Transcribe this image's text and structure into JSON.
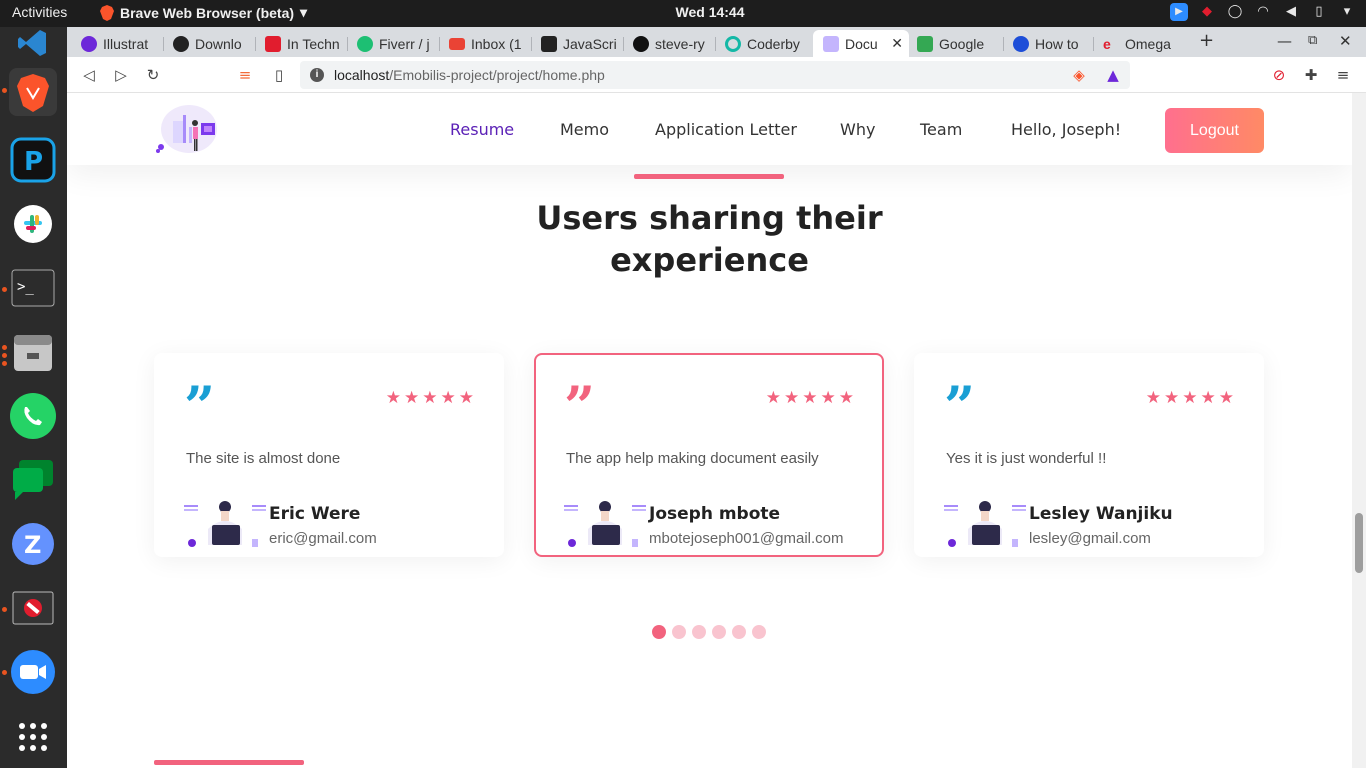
{
  "topbar": {
    "activities": "Activities",
    "app_name": "Brave Web Browser (beta)",
    "clock": "Wed 14:44"
  },
  "browser": {
    "tabs": [
      {
        "label": "Illustrat",
        "color": "#6d28d9"
      },
      {
        "label": "Downlo",
        "color": "#222222"
      },
      {
        "label": "In Techn",
        "color": "#e11d2e"
      },
      {
        "label": "Fiverr / j",
        "color": "#1dbf73"
      },
      {
        "label": "Inbox (1",
        "color": "#ea4335"
      },
      {
        "label": "JavaScri",
        "color": "#222222"
      },
      {
        "label": "steve-ry",
        "color": "#111111"
      },
      {
        "label": "Coderby",
        "color": "#14b8a6"
      },
      {
        "label": "Docu",
        "color": "#7c3aed"
      },
      {
        "label": "Google",
        "color": "#34a853"
      },
      {
        "label": "How to",
        "color": "#1d4ed8"
      },
      {
        "label": "Omega",
        "color": "#e11d2e"
      }
    ],
    "url_host": "localhost",
    "url_path": "/Emobilis-project/project/home.php"
  },
  "site": {
    "nav": [
      {
        "label": "Resume"
      },
      {
        "label": "Memo"
      },
      {
        "label": "Application Letter"
      },
      {
        "label": "Why"
      },
      {
        "label": "Team"
      },
      {
        "label": "Hello, Joseph!"
      }
    ],
    "logout_label": "Logout",
    "section_title_bold": "Users sharing",
    "section_title_rest": " their experience",
    "accent_color": "#f2637e",
    "testimonials": [
      {
        "text": "The site is almost done",
        "name": "Eric Were",
        "email": "eric@gmail.com",
        "rating": 5,
        "quote_color": "#1a9fd4"
      },
      {
        "text": "The app help making document easily",
        "name": "Joseph mbote",
        "email": "mbotejoseph001@gmail.com",
        "rating": 5,
        "quote_color": "#f2637e"
      },
      {
        "text": "Yes it is just wonderful !!",
        "name": "Lesley Wanjiku",
        "email": "lesley@gmail.com",
        "rating": 5,
        "quote_color": "#1a9fd4"
      }
    ],
    "carousel_pages": 6,
    "carousel_active": 1
  }
}
